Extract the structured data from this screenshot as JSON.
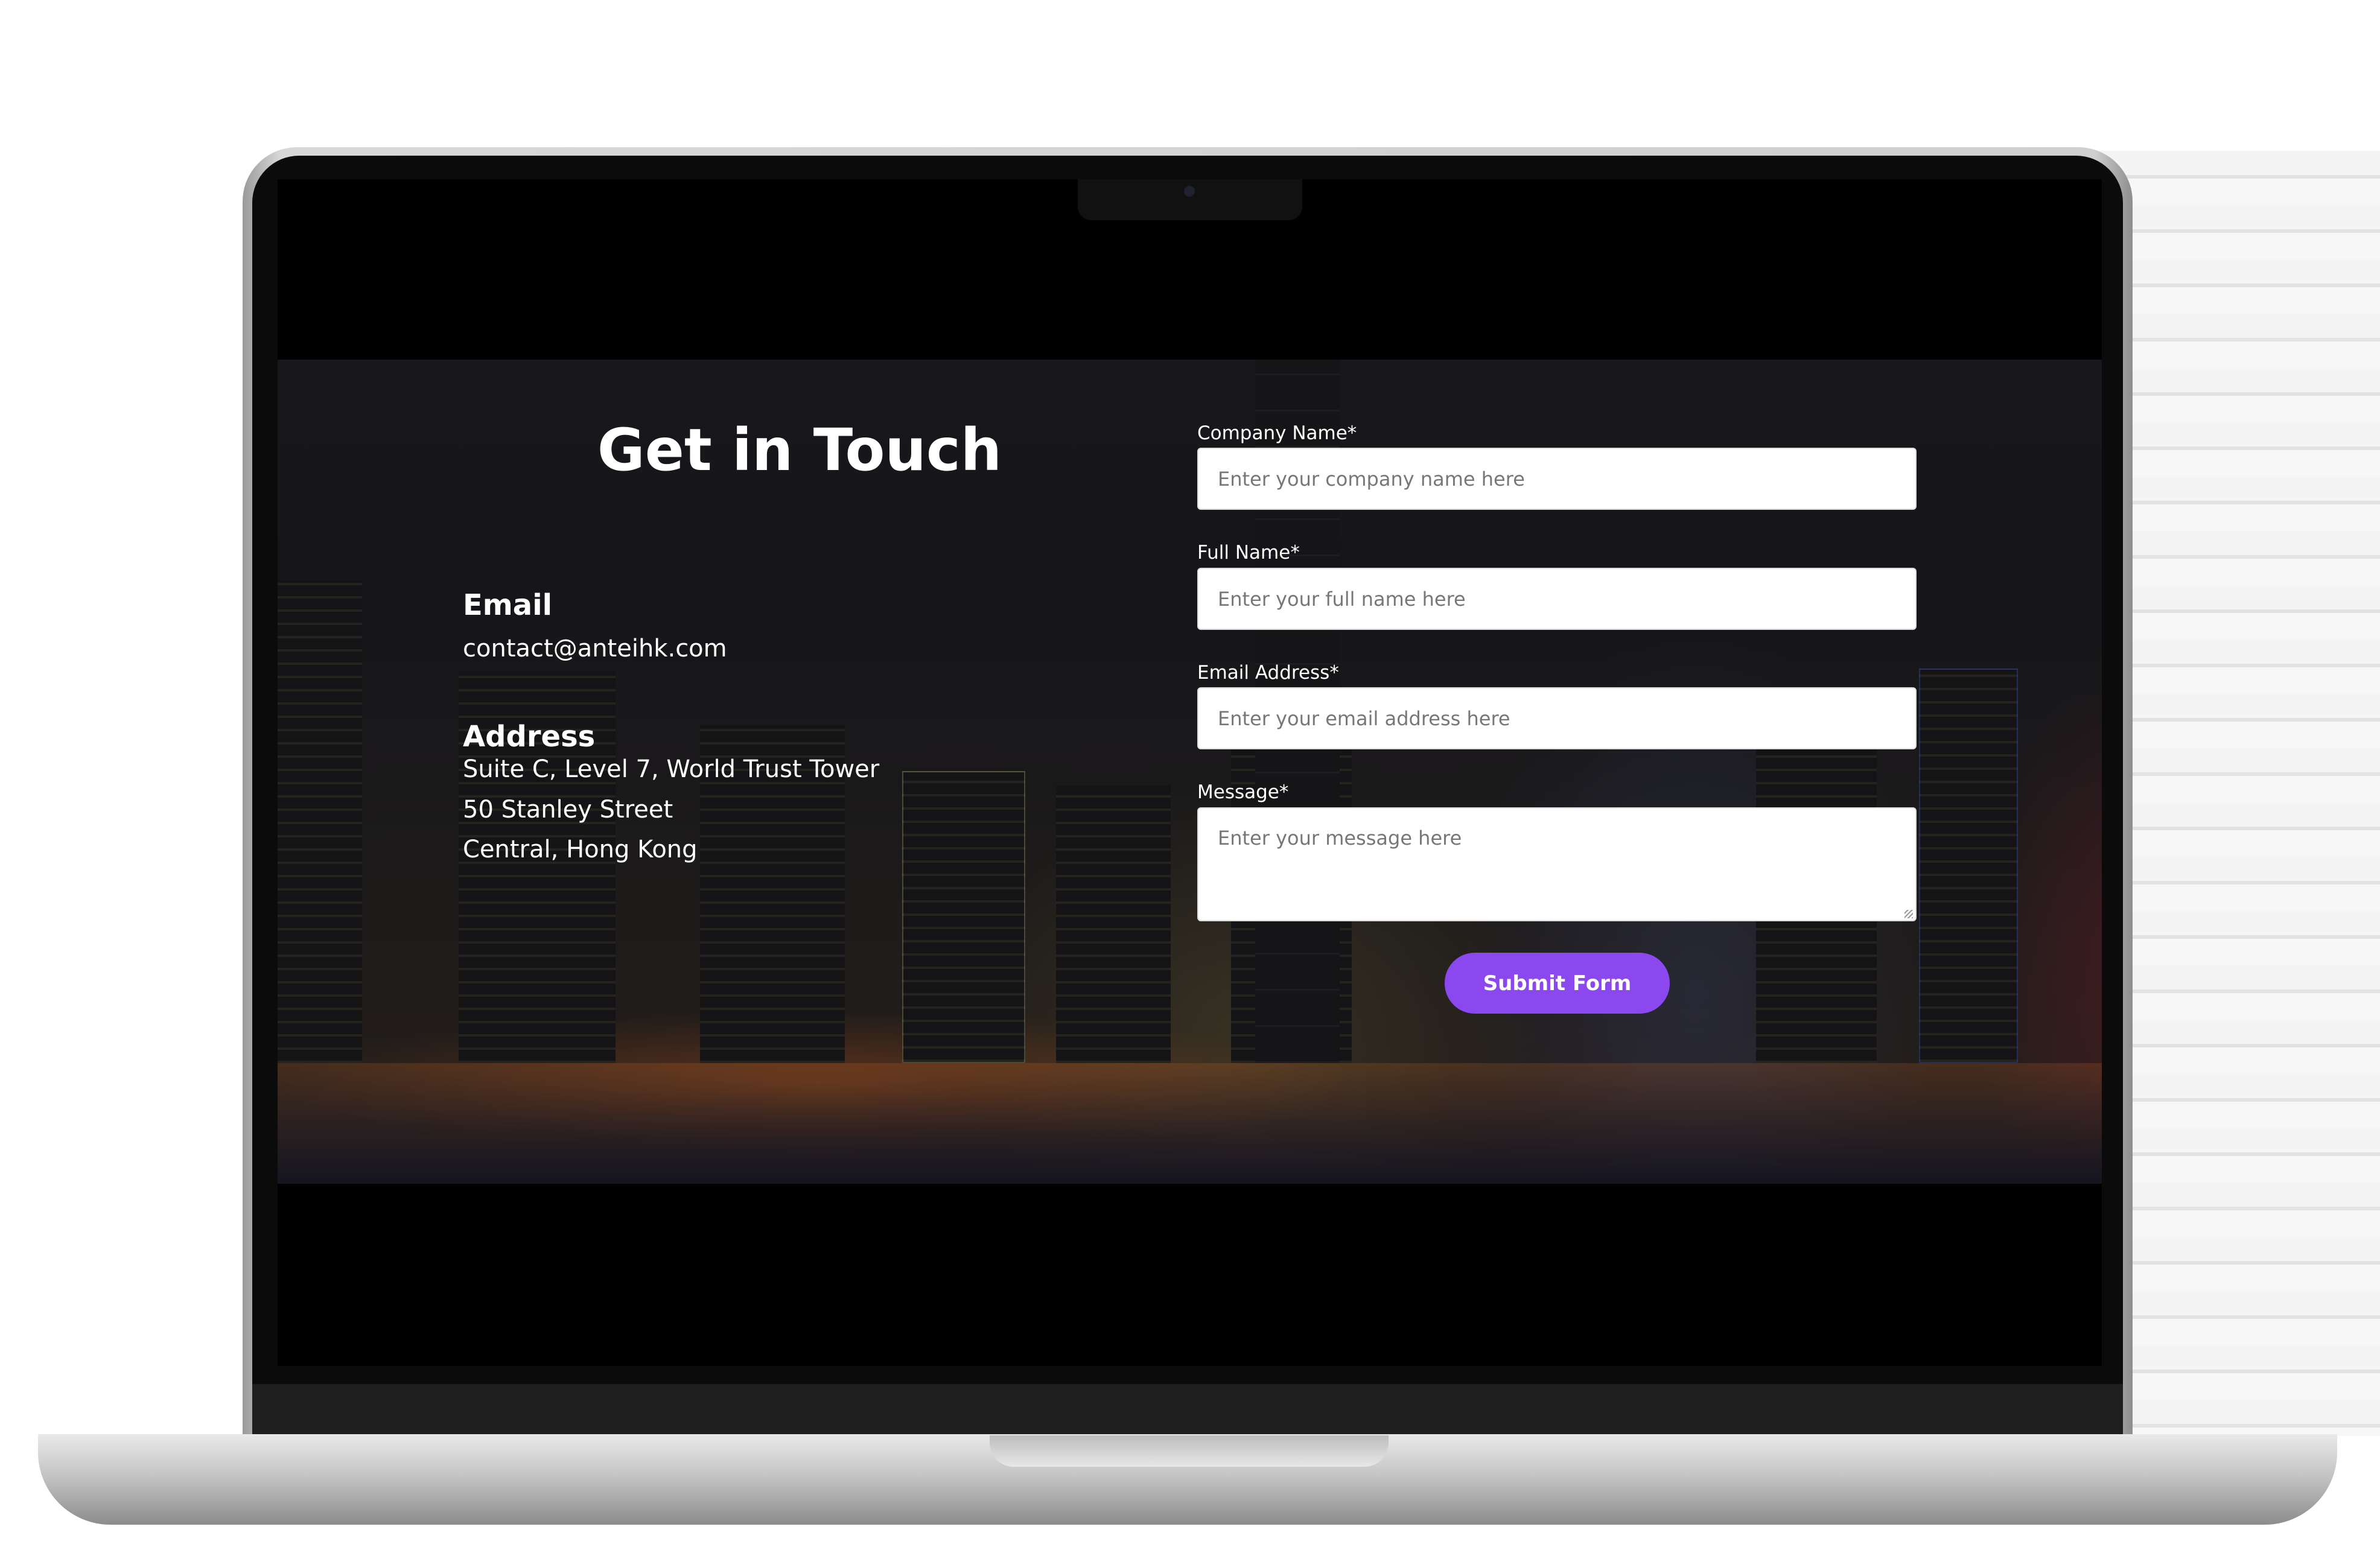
{
  "contact": {
    "title": "Get in Touch",
    "email_heading": "Email",
    "email_value": "contact@anteihk.com",
    "address_heading": "Address",
    "address_lines": [
      "Suite C, Level 7, World Trust Tower",
      "50 Stanley Street",
      "Central, Hong Kong"
    ]
  },
  "form": {
    "fields": [
      {
        "label": "Company Name*",
        "placeholder": "Enter your company name here"
      },
      {
        "label": "Full Name*",
        "placeholder": "Enter your full name here"
      },
      {
        "label": "Email Address*",
        "placeholder": "Enter your email address here"
      },
      {
        "label": "Message*",
        "placeholder": "Enter your message here"
      }
    ],
    "submit_label": "Submit Form"
  },
  "colors": {
    "accent": "#8b48ee",
    "background": "#18181c"
  }
}
